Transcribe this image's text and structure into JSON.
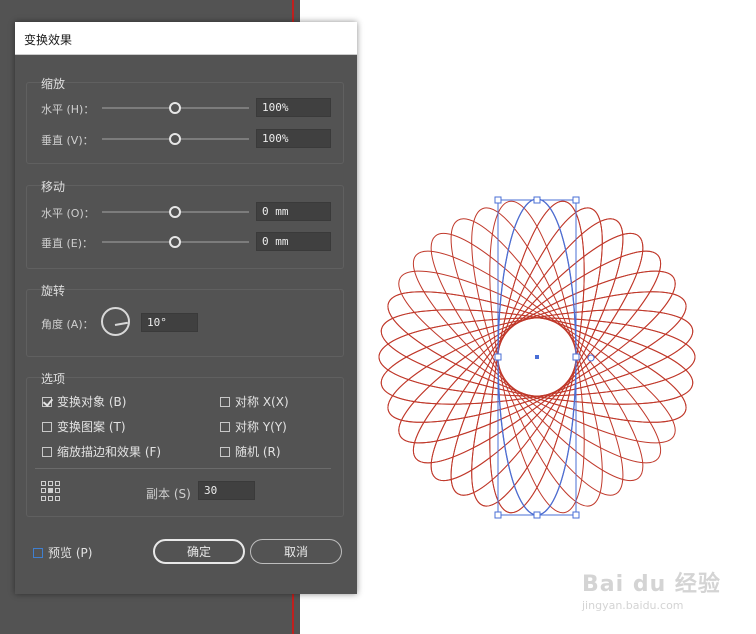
{
  "dialog": {
    "title": "变换效果"
  },
  "scale": {
    "title": "缩放",
    "horizontal": {
      "label": "水平 (H)：",
      "value": "100%",
      "slider_fraction": 0.5
    },
    "vertical": {
      "label": "垂直 (V)：",
      "value": "100%",
      "slider_fraction": 0.5
    }
  },
  "move": {
    "title": "移动",
    "horizontal": {
      "label": "水平 (O)：",
      "value": "0 mm",
      "slider_fraction": 0.5
    },
    "vertical": {
      "label": "垂直 (E)：",
      "value": "0 mm",
      "slider_fraction": 0.5
    }
  },
  "rotate": {
    "title": "旋转",
    "angle_label": "角度 (A)：",
    "angle_value": "10°"
  },
  "options": {
    "title": "选项",
    "transform_objects": {
      "label": "变换对象 (B)",
      "checked": true
    },
    "transform_patterns": {
      "label": "变换图案 (T)",
      "checked": false
    },
    "scale_strokes": {
      "label": "缩放描边和效果 (F)",
      "checked": false
    },
    "reflect_x": {
      "label": "对称 X(X)",
      "checked": false
    },
    "reflect_y": {
      "label": "对称 Y(Y)",
      "checked": false
    },
    "random": {
      "label": "随机 (R)",
      "checked": false
    }
  },
  "copies": {
    "label": "副本 (S)",
    "value": "30"
  },
  "preview": {
    "label": "预览 (P)",
    "checked": false
  },
  "buttons": {
    "ok": "确定",
    "cancel": "取消"
  },
  "artwork": {
    "stroke_color": "#c0392b",
    "selection_color": "#4a6fd6",
    "copies": 30,
    "rotation_deg": 10
  },
  "watermark": {
    "brand": "Bai du 经验",
    "url": "jingyan.baidu.com"
  }
}
